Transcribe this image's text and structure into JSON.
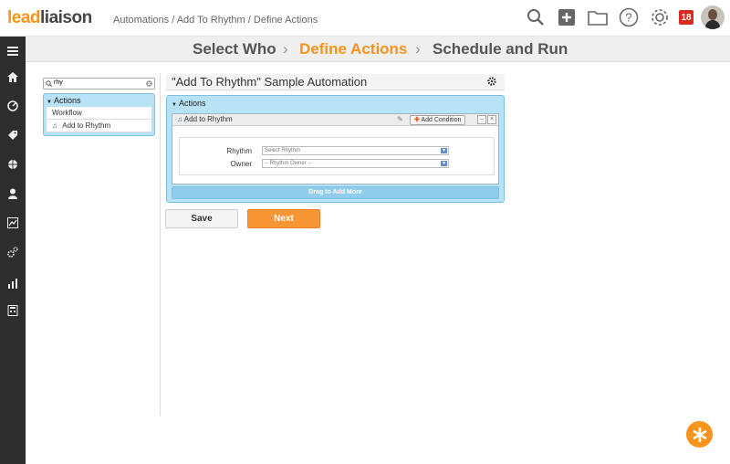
{
  "header": {
    "logo_lead": "lead",
    "logo_liaison": "liaison",
    "breadcrumb": "Automations / Add To Rhythm / Define Actions",
    "notification_count": "18",
    "icons": [
      "search-icon",
      "add-icon",
      "folder-icon",
      "help-icon",
      "settings-icon"
    ]
  },
  "sidebar": {
    "icons": [
      "menu-icon",
      "home-icon",
      "dashboard-icon",
      "tag-icon",
      "globe-icon",
      "user-icon",
      "reports-icon",
      "automation-icon",
      "analytics-icon",
      "calculator-icon"
    ]
  },
  "steps": {
    "step1": "Select Who",
    "step2": "Define Actions",
    "step3": "Schedule and Run",
    "active": "Define Actions"
  },
  "left_panel": {
    "search_value": "rhy",
    "tree_header": "Actions",
    "items": [
      {
        "label": "Workflow"
      },
      {
        "label": "Add to Rhythm",
        "icon": "music-note-icon"
      }
    ]
  },
  "main": {
    "title": "\"Add To Rhythm\" Sample Automation",
    "actions_header": "Actions",
    "card": {
      "title": "Add to Rhythm",
      "add_condition": "Add Condition",
      "fields": [
        {
          "label": "Rhythm",
          "value": "Select Rhythm"
        },
        {
          "label": "Owner",
          "value": "-- Rhythm Owner --"
        }
      ]
    },
    "drag_label": "Drag to Add More",
    "save_label": "Save",
    "next_label": "Next"
  },
  "colors": {
    "accent": "#f7941d",
    "panel_blue": "#b8e2f6",
    "sidebar": "#2d2d2d",
    "badge": "#d92b1e"
  }
}
